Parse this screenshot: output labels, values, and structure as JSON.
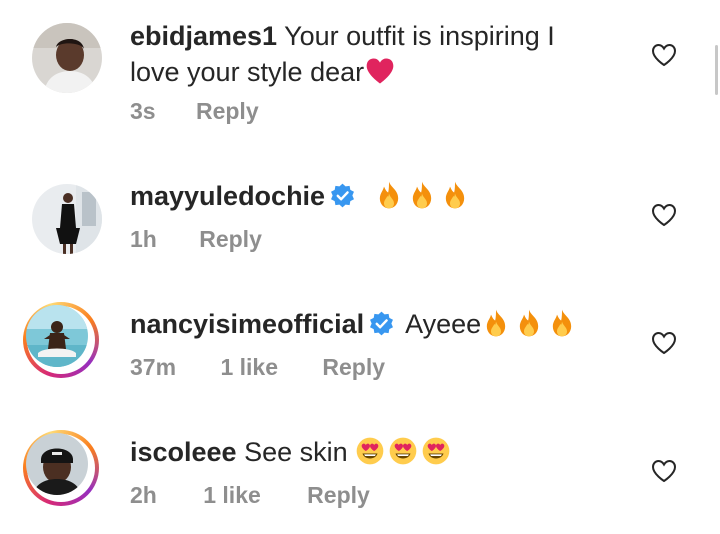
{
  "comments": [
    {
      "username": "ebidjames1",
      "text_line1": "Your outfit is inspiring I",
      "text_line2": "love your style dear",
      "verified": false,
      "emoji": "heart",
      "time": "3s",
      "likes": "",
      "reply_label": "Reply"
    },
    {
      "username": "mayyuledochie",
      "text": "",
      "verified": true,
      "emoji": "fire x3",
      "time": "1h",
      "likes": "",
      "reply_label": "Reply"
    },
    {
      "username": "nancyisimeofficial",
      "text": "Ayeee",
      "verified": true,
      "emoji": "fire x3",
      "time": "37m",
      "likes": "1 like",
      "reply_label": "Reply"
    },
    {
      "username": "iscoleee",
      "text": "See skin",
      "verified": false,
      "emoji": "heart-eyes x3",
      "time": "2h",
      "likes": "1 like",
      "reply_label": "Reply"
    }
  ],
  "colors": {
    "text": "#262626",
    "meta": "#8e8e8e",
    "verified": "#3897f0",
    "heart_emoji": "#e0245e",
    "fire": "#f4900c"
  }
}
